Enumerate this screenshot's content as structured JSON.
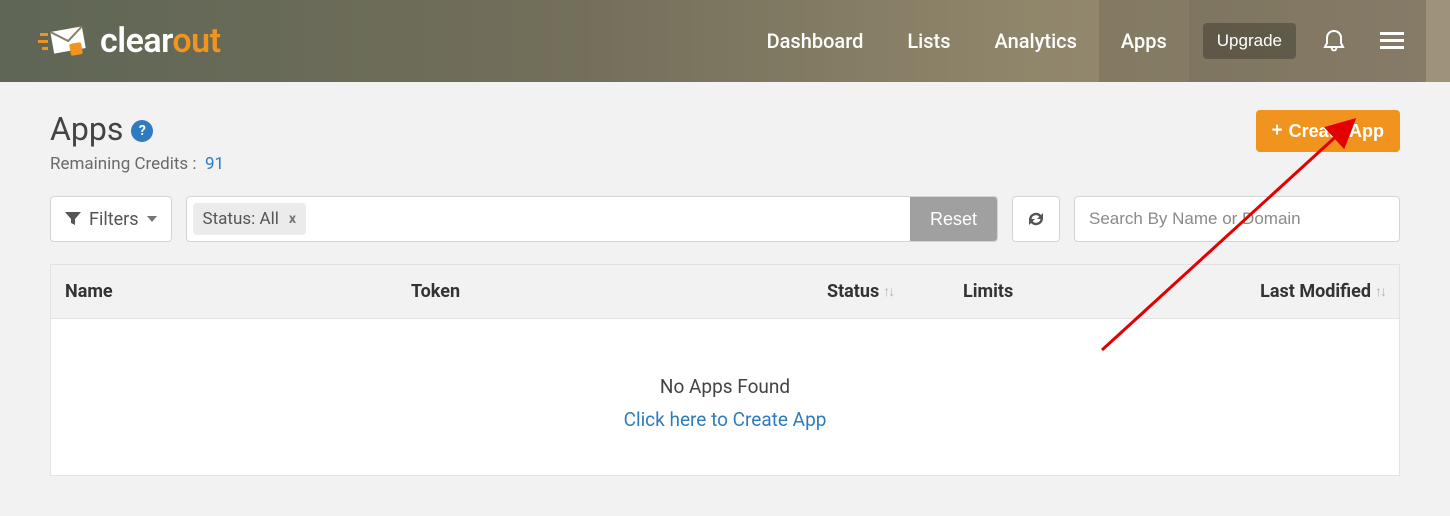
{
  "brand": {
    "name_part1": "clear",
    "name_part2": "out"
  },
  "nav": {
    "items": [
      {
        "label": "Dashboard"
      },
      {
        "label": "Lists"
      },
      {
        "label": "Analytics"
      },
      {
        "label": "Apps"
      }
    ],
    "active_index": 3,
    "upgrade_label": "Upgrade"
  },
  "page": {
    "title": "Apps",
    "help_symbol": "?",
    "credits_label": "Remaining Credits :",
    "credits_value": "91",
    "create_button_label": "Create App"
  },
  "filters": {
    "button_label": "Filters",
    "chip_label": "Status: All",
    "chip_close": "x",
    "reset_label": "Reset",
    "search_placeholder": "Search By Name or Domain"
  },
  "table": {
    "columns": {
      "name": "Name",
      "token": "Token",
      "status": "Status",
      "limits": "Limits",
      "modified": "Last Modified"
    },
    "sort_glyph": "↑↓",
    "empty_message": "No Apps Found",
    "empty_link": "Click here to Create App"
  }
}
